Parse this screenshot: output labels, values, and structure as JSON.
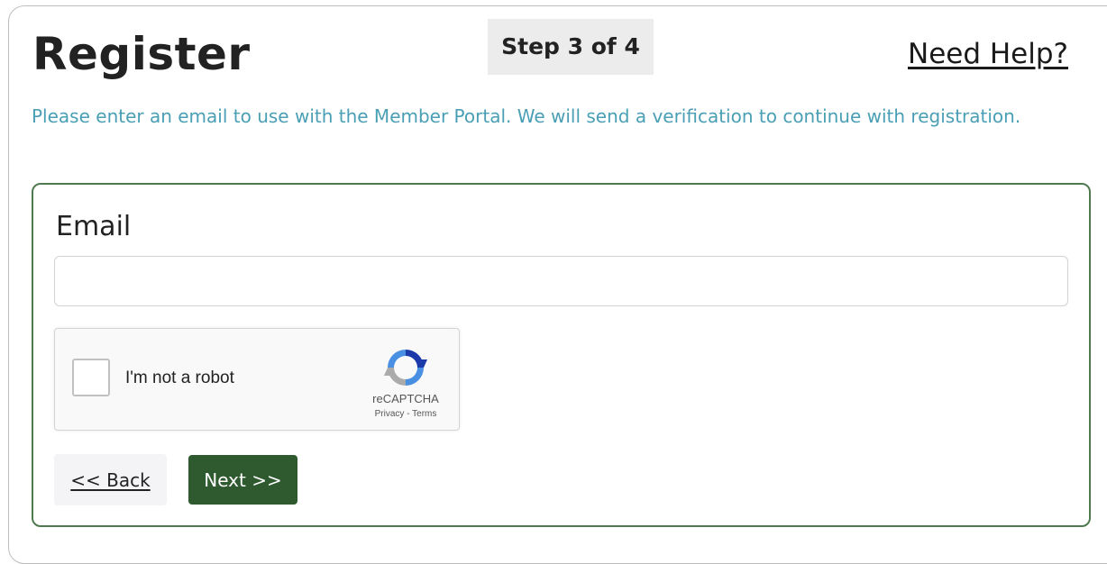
{
  "header": {
    "title": "Register",
    "step": "Step 3 of 4",
    "help_link": "Need Help?"
  },
  "intro_text": "Please enter an email to use with the Member Portal. We will send a verification to continue with registration.",
  "form": {
    "email_label": "Email",
    "email_value": "",
    "email_placeholder": ""
  },
  "captcha": {
    "label": "I'm not a robot",
    "brand": "reCAPTCHA",
    "privacy": "Privacy",
    "separator": " - ",
    "terms": "Terms",
    "logo_icon": "recaptcha-logo-icon"
  },
  "buttons": {
    "back": "<< Back",
    "next": "Next >>"
  },
  "colors": {
    "intro_text": "#4a9fb5",
    "form_border": "#4f7a4f",
    "next_button": "#2f5a2f",
    "step_badge": "#ececec"
  }
}
